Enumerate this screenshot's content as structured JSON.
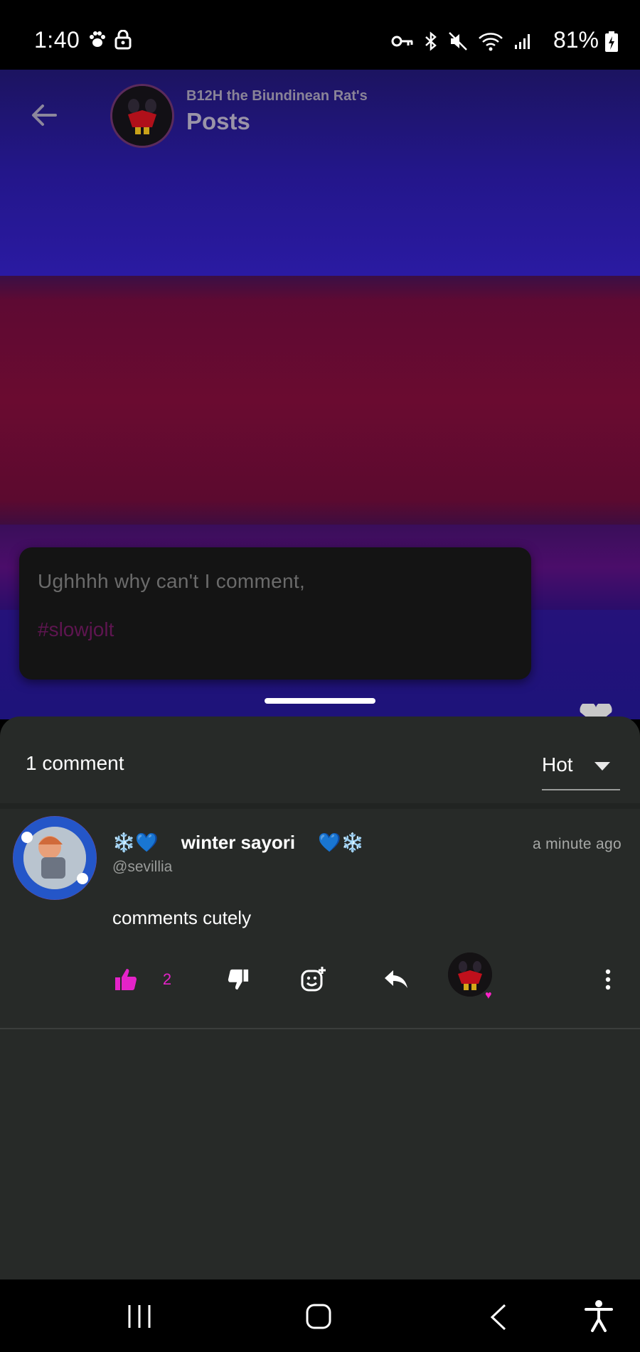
{
  "status_bar": {
    "time": "1:40",
    "battery": "81%"
  },
  "header": {
    "subtitle": "B12H the Biundinean Rat's",
    "title": "Posts"
  },
  "post": {
    "text": "Ughhhh why can't I comment,",
    "hashtag": "#slowjolt"
  },
  "comments_sheet": {
    "count_label": "1 comment",
    "sort": {
      "selected": "Hot"
    }
  },
  "comment": {
    "name_prefix": "❄️💙",
    "name": "winter sayori",
    "name_suffix": "💙❄️",
    "handle": "@sevillia",
    "time": "a minute ago",
    "body": "comments cutely",
    "likes": "2"
  },
  "colors": {
    "accent_pink": "#e423c8",
    "sheet_bg": "#272a28",
    "post_card_bg": "#141414"
  },
  "icons": {
    "back": "arrow-left-icon",
    "like": "thumbs-up-icon",
    "dislike": "thumbs-down-icon",
    "react": "add-reaction-icon",
    "reply": "reply-icon",
    "more": "more-vertical-icon"
  }
}
